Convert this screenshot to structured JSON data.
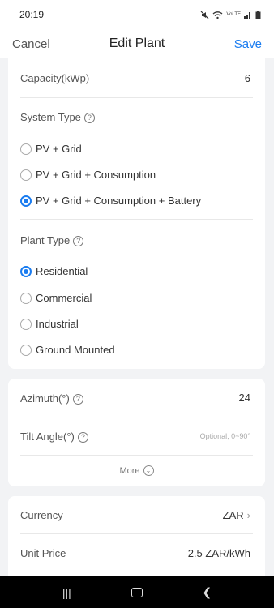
{
  "status_bar": {
    "time": "20:19",
    "icons": [
      "mute-icon",
      "wifi-icon",
      "volte-icon",
      "signal-icon",
      "battery-icon"
    ],
    "volte_text": "VoLTE"
  },
  "nav": {
    "cancel": "Cancel",
    "title": "Edit Plant",
    "save": "Save",
    "accent": "#1a7cf0"
  },
  "capacity": {
    "label": "Capacity(kWp)",
    "value": "6"
  },
  "system_type": {
    "label": "System Type",
    "options": [
      {
        "label": "PV + Grid",
        "checked": false
      },
      {
        "label": "PV + Grid + Consumption",
        "checked": false
      },
      {
        "label": "PV + Grid + Consumption + Battery",
        "checked": true
      }
    ]
  },
  "plant_type": {
    "label": "Plant Type",
    "options": [
      {
        "label": "Residential",
        "checked": true
      },
      {
        "label": "Commercial",
        "checked": false
      },
      {
        "label": "Industrial",
        "checked": false
      },
      {
        "label": "Ground Mounted",
        "checked": false
      }
    ]
  },
  "azimuth": {
    "label": "Azimuth(°)",
    "value": "24"
  },
  "tilt": {
    "label": "Tilt Angle(°)",
    "placeholder": "Optional, 0~90°"
  },
  "more": {
    "label": "More"
  },
  "currency": {
    "label": "Currency",
    "value": "ZAR"
  },
  "unit_price": {
    "label": "Unit Price",
    "value": "2.5 ZAR/kWh"
  }
}
